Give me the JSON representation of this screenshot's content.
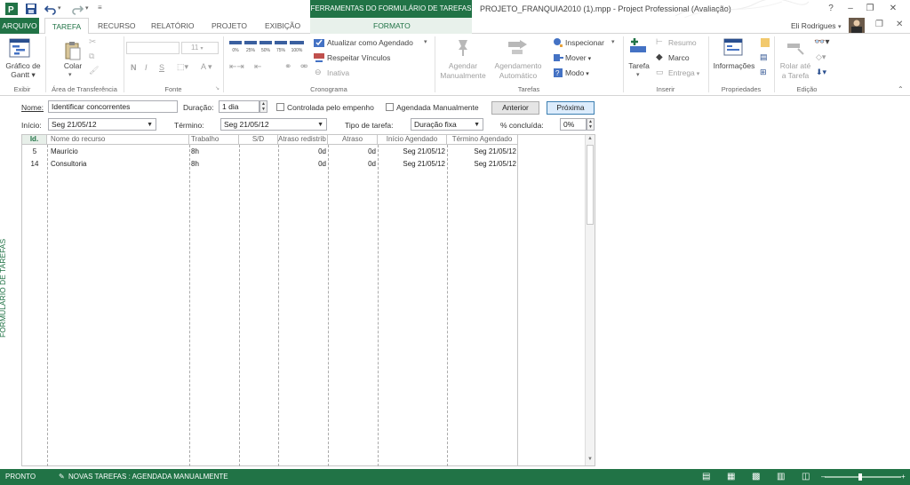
{
  "title_bar": {
    "context_group": "FERRAMENTAS DO FORMULÁRIO DE TAREFAS",
    "window_title": "PROJETO_FRANQUIA2010 (1).mpp - Project Professional (Avaliação)",
    "help": "?",
    "minimize": "–",
    "restore": "❐",
    "close": "✕"
  },
  "tabs": {
    "arquivo": "ARQUIVO",
    "tarefa": "TAREFA",
    "recurso": "RECURSO",
    "relatorio": "RELATÓRIO",
    "projeto": "PROJETO",
    "exibicao": "EXIBIÇÃO",
    "formato": "FORMATO",
    "user": "Eli Rodrigues"
  },
  "ribbon": {
    "exibir": {
      "gantt_line1": "Gráfico de",
      "gantt_line2": "Gantt",
      "label": "Exibir"
    },
    "clipboard": {
      "colar": "Colar",
      "label": "Área de Transferência"
    },
    "fonte": {
      "size": "11",
      "bold": "N",
      "italic": "I",
      "underline": "S",
      "label": "Fonte"
    },
    "cronograma": {
      "pcts": [
        "0%",
        "25%",
        "50%",
        "75%",
        "100%"
      ],
      "atualizar": "Atualizar como Agendado",
      "respeitar": "Respeitar Vínculos",
      "inativa": "Inativa",
      "label": "Cronograma"
    },
    "tarefas": {
      "manual_1": "Agendar",
      "manual_2": "Manualmente",
      "auto_1": "Agendamento",
      "auto_2": "Automático",
      "inspecionar": "Inspecionar",
      "mover": "Mover",
      "modo": "Modo",
      "label": "Tarefas"
    },
    "inserir": {
      "tarefa": "Tarefa",
      "resumo": "Resumo",
      "marco": "Marco",
      "entrega": "Entrega",
      "label": "Inserir"
    },
    "propriedades": {
      "informacoes": "Informações",
      "label": "Propriedades"
    },
    "edicao": {
      "rolar_1": "Rolar até",
      "rolar_2": "a Tarefa",
      "label": "Edição"
    }
  },
  "side_label": "FORMULÁRIO DE TAREFAS",
  "form": {
    "nome_label": "Nome:",
    "nome_value": "Identificar concorrentes",
    "duracao_label": "Duração:",
    "duracao_value": "1 dia",
    "controlada_label": "Controlada pelo empenho",
    "agendada_label": "Agendada Manualmente",
    "anterior": "Anterior",
    "proxima": "Próxima",
    "inicio_label": "Início:",
    "inicio_value": "Seg 21/05/12",
    "termino_label": "Término:",
    "termino_value": "Seg 21/05/12",
    "tipo_label": "Tipo de tarefa:",
    "tipo_value": "Duração fixa",
    "pct_label": "% concluída:",
    "pct_value": "0%"
  },
  "grid": {
    "headers": [
      "Id.",
      "Nome do recurso",
      "Trabalho",
      "S/D",
      "Atraso redistrib",
      "Atraso",
      "Início Agendado",
      "Término Agendado"
    ],
    "rows": [
      {
        "id": "5",
        "name": "Maurício",
        "work": "8h",
        "sd": "",
        "redist": "0d",
        "delay": "0d",
        "start": "Seg 21/05/12",
        "finish": "Seg 21/05/12"
      },
      {
        "id": "14",
        "name": "Consultoria",
        "work": "8h",
        "sd": "",
        "redist": "0d",
        "delay": "0d",
        "start": "Seg 21/05/12",
        "finish": "Seg 21/05/12"
      }
    ]
  },
  "status": {
    "pronto": "PRONTO",
    "novas": "NOVAS TAREFAS : AGENDADA MANUALMENTE"
  },
  "colors": {
    "accent": "#217346",
    "context_band": "#217346"
  }
}
